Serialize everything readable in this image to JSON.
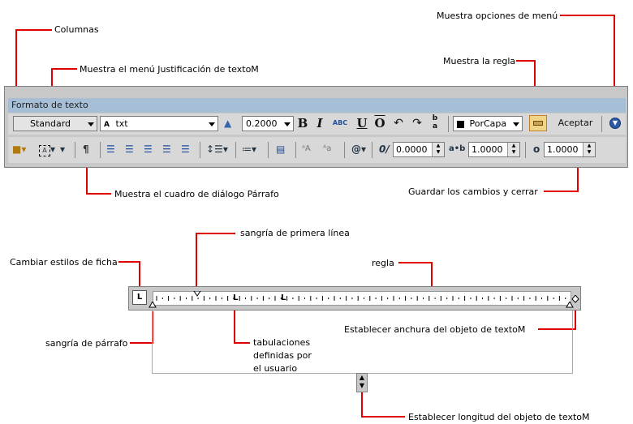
{
  "toolbar": {
    "title": "Formato de texto",
    "style_value": "Standard",
    "font_value": "txt",
    "font_prefix": "A",
    "height_value": "0.2000",
    "bold": "B",
    "italic": "I",
    "underline": "U",
    "overline": "O",
    "undo": "↶",
    "redo": "↷",
    "stack_top": "b",
    "stack_bottom": "a",
    "color_value": "PorCapa",
    "accept": "Aceptar",
    "oblique_value": "0.0000",
    "tracking_value": "1.0000",
    "width_value": "1.0000",
    "tracking_label": "a•b",
    "oblique_label": "0/",
    "width_label": "o",
    "symbol": "@"
  },
  "callouts": {
    "menu_options": "Muestra opciones de menú",
    "columns": "Columnas",
    "justification": "Muestra el menú Justificación de textoM",
    "show_ruler": "Muestra la regla",
    "paragraph_dialog": "Muestra el cuadro de diálogo Párrafo",
    "save_close": "Guardar los cambios y cerrar",
    "first_line_indent": "sangría de primera línea",
    "tab_styles": "Cambiar estilos de ficha",
    "ruler": "regla",
    "paragraph_indent": "sangría de párrafo",
    "user_tabs_1": "tabulaciones",
    "user_tabs_2": "definidas por",
    "user_tabs_3": "el usuario",
    "set_width": "Establecer anchura del objeto de textoM",
    "set_length": "Establecer longitud del objeto de textoM"
  },
  "ruler": {
    "tab_style_glyph": "L",
    "tab_marker": "L"
  },
  "colors": {
    "callout_line": "#e00000",
    "titlebar": "#a6bfd6",
    "toolbar_bg": "#c8c8c8"
  }
}
